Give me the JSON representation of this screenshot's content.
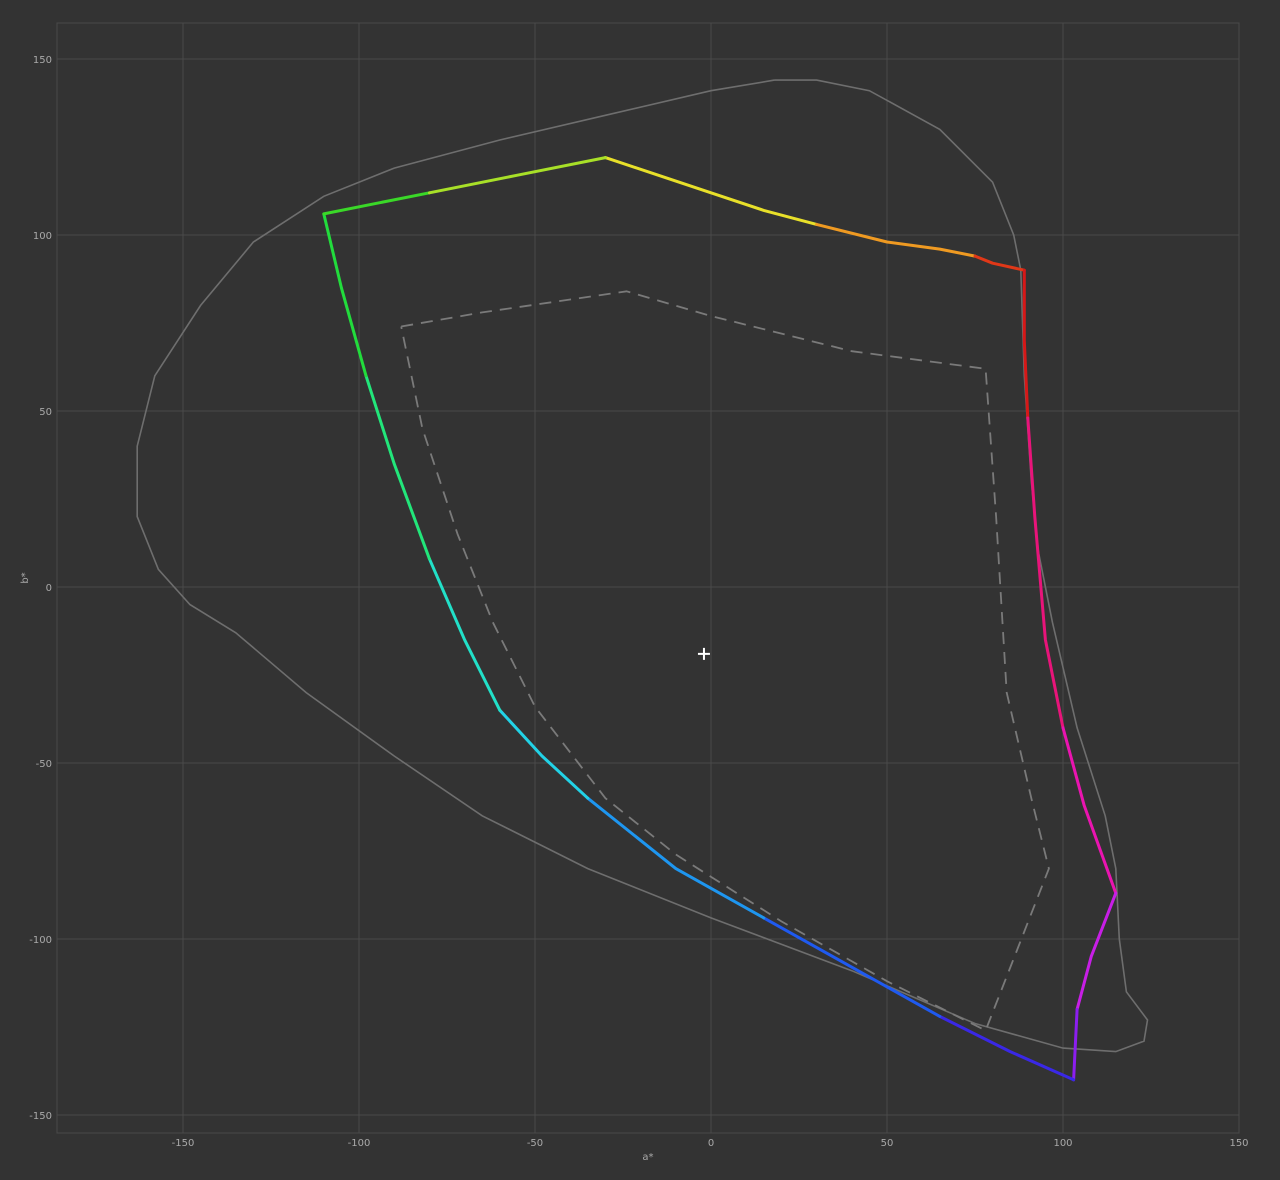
{
  "chart_data": {
    "type": "line",
    "xlabel": "a*",
    "ylabel": "b*",
    "xlim": [
      -186,
      150
    ],
    "ylim": [
      -155,
      160
    ],
    "x_ticks": [
      -150,
      -100,
      -50,
      0,
      50,
      100,
      150
    ],
    "y_ticks": [
      150,
      100,
      50,
      0,
      -50,
      -100,
      -150
    ],
    "grid": true,
    "series": [
      {
        "role": "spectral-locus",
        "style": "solid thin gray",
        "color": "#6e6e6e",
        "points": [
          [
            18,
            144
          ],
          [
            0,
            141
          ],
          [
            -30,
            134
          ],
          [
            -60,
            127
          ],
          [
            -90,
            119
          ],
          [
            -110,
            111
          ],
          [
            -130,
            98
          ],
          [
            -145,
            80
          ],
          [
            -158,
            60
          ],
          [
            -163,
            40
          ],
          [
            -163,
            20
          ],
          [
            -157,
            5
          ],
          [
            -148,
            -5
          ],
          [
            -135,
            -13
          ],
          [
            -115,
            -30
          ],
          [
            -90,
            -48
          ],
          [
            -65,
            -65
          ],
          [
            -35,
            -80
          ],
          [
            0,
            -94
          ],
          [
            40,
            -109
          ],
          [
            75,
            -124
          ],
          [
            100,
            -131
          ],
          [
            115,
            -132
          ],
          [
            123,
            -129
          ],
          [
            124,
            -123
          ],
          [
            118,
            -115
          ],
          [
            116,
            -100
          ],
          [
            115,
            -80
          ],
          [
            112,
            -65
          ],
          [
            104,
            -40
          ],
          [
            97,
            -10
          ],
          [
            93,
            10
          ],
          [
            91,
            30
          ],
          [
            89,
            60
          ],
          [
            88,
            90
          ],
          [
            86,
            100
          ],
          [
            80,
            115
          ],
          [
            65,
            130
          ],
          [
            45,
            141
          ],
          [
            30,
            144
          ],
          [
            18,
            144
          ]
        ]
      },
      {
        "role": "reference-gamut",
        "style": "dashed gray",
        "color": "#7a7a7a",
        "points": [
          [
            -88,
            74
          ],
          [
            -65,
            78
          ],
          [
            -24,
            84
          ],
          [
            0,
            77
          ],
          [
            40,
            67
          ],
          [
            78,
            62
          ],
          [
            81,
            20
          ],
          [
            84,
            -30
          ],
          [
            91,
            -60
          ],
          [
            96,
            -80
          ],
          [
            78,
            -126
          ],
          [
            50,
            -112
          ],
          [
            20,
            -95
          ],
          [
            -10,
            -76
          ],
          [
            -30,
            -60
          ],
          [
            -50,
            -34
          ],
          [
            -62,
            -10
          ],
          [
            -72,
            15
          ],
          [
            -82,
            45
          ],
          [
            -88,
            74
          ]
        ]
      },
      {
        "role": "measured-gamut",
        "style": "solid thick hue gradient",
        "segments": [
          {
            "color": "#e8e02a",
            "points": [
              [
                -30,
                122
              ],
              [
                -15,
                117
              ],
              [
                0,
                112
              ],
              [
                15,
                107
              ],
              [
                30,
                103
              ]
            ]
          },
          {
            "color": "#ef9a22",
            "points": [
              [
                30,
                103
              ],
              [
                50,
                98
              ],
              [
                65,
                96
              ],
              [
                75,
                94
              ]
            ]
          },
          {
            "color": "#e03818",
            "points": [
              [
                75,
                94
              ],
              [
                80,
                92
              ],
              [
                89,
                90
              ]
            ]
          },
          {
            "color": "#d61818",
            "points": [
              [
                89,
                90
              ],
              [
                89,
                70
              ],
              [
                90,
                48
              ]
            ]
          },
          {
            "color": "#e8147a",
            "points": [
              [
                90,
                48
              ],
              [
                92,
                20
              ],
              [
                95,
                -15
              ],
              [
                100,
                -40
              ]
            ]
          },
          {
            "color": "#ea14b0",
            "points": [
              [
                100,
                -40
              ],
              [
                106,
                -62
              ],
              [
                115,
                -87
              ]
            ]
          },
          {
            "color": "#c81ee6",
            "points": [
              [
                115,
                -87
              ],
              [
                108,
                -105
              ],
              [
                104,
                -120
              ]
            ]
          },
          {
            "color": "#8c1ef0",
            "points": [
              [
                104,
                -120
              ],
              [
                103,
                -140
              ]
            ]
          },
          {
            "color": "#3a28e6",
            "points": [
              [
                103,
                -140
              ],
              [
                85,
                -132
              ],
              [
                65,
                -122
              ]
            ]
          },
          {
            "color": "#1f5af0",
            "points": [
              [
                65,
                -122
              ],
              [
                40,
                -108
              ],
              [
                15,
                -94
              ]
            ]
          },
          {
            "color": "#1e96f0",
            "points": [
              [
                15,
                -94
              ],
              [
                -10,
                -80
              ],
              [
                -35,
                -60
              ]
            ]
          },
          {
            "color": "#22d2e6",
            "points": [
              [
                -35,
                -60
              ],
              [
                -48,
                -48
              ],
              [
                -60,
                -35
              ]
            ]
          },
          {
            "color": "#22e0c8",
            "points": [
              [
                -60,
                -35
              ],
              [
                -70,
                -15
              ],
              [
                -80,
                8
              ]
            ]
          },
          {
            "color": "#22e67a",
            "points": [
              [
                -80,
                8
              ],
              [
                -90,
                35
              ],
              [
                -98,
                60
              ]
            ]
          },
          {
            "color": "#22dc3c",
            "points": [
              [
                -98,
                60
              ],
              [
                -105,
                85
              ],
              [
                -110,
                106
              ]
            ]
          },
          {
            "color": "#3ad828",
            "points": [
              [
                -110,
                106
              ],
              [
                -95,
                109
              ],
              [
                -80,
                112
              ]
            ]
          },
          {
            "color": "#a8e028",
            "points": [
              [
                -80,
                112
              ],
              [
                -55,
                117
              ],
              [
                -30,
                122
              ]
            ]
          }
        ]
      }
    ],
    "white_point": {
      "a": -2,
      "b": -19,
      "symbol": "+"
    }
  }
}
